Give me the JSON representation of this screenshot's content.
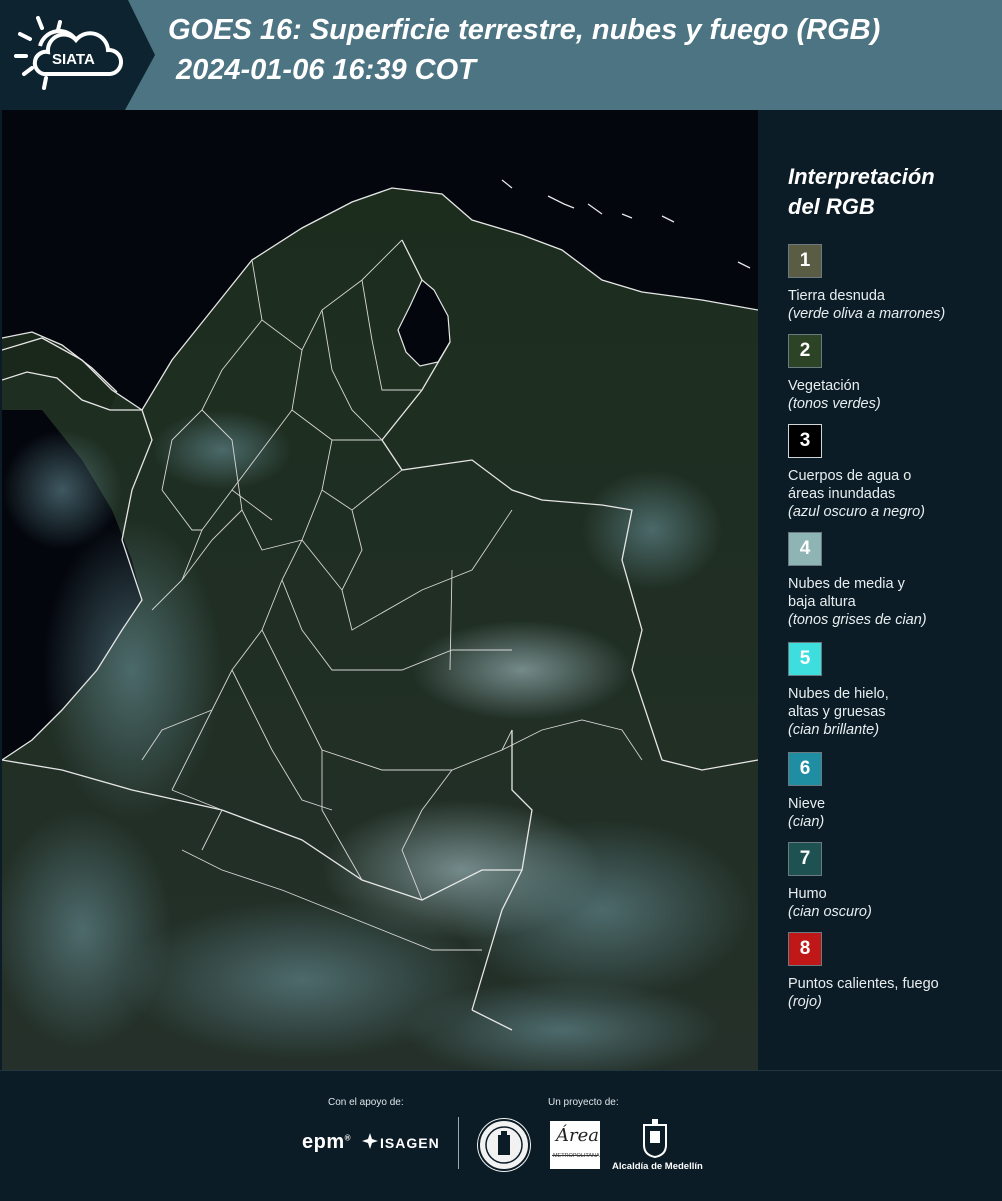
{
  "header": {
    "logo_text": "SIATA",
    "title_line1": "GOES 16: Superficie terrestre, nubes y fuego (RGB)",
    "title_line2": "2024-01-06 16:39 COT"
  },
  "legend": {
    "heading_line1": "Interpretación",
    "heading_line2": "del RGB",
    "items": [
      {
        "number": "1",
        "label": "Tierra desnuda",
        "sub": "(verde oliva a marrones)",
        "color": "#5a5c44"
      },
      {
        "number": "2",
        "label": "Vegetación",
        "sub": "(tonos verdes)",
        "color": "#2d4326"
      },
      {
        "number": "3",
        "label": "Cuerpos de agua o\náreas inundadas",
        "sub": "(azul oscuro a negro)",
        "color": "#000000"
      },
      {
        "number": "4",
        "label": "Nubes de media y\nbaja altura",
        "sub": "(tonos grises de cian)",
        "color": "#8eb4b4"
      },
      {
        "number": "5",
        "label": "Nubes de hielo,\naltas y gruesas",
        "sub": "(cian brillante)",
        "color": "#3fdede"
      },
      {
        "number": "6",
        "label": "Nieve",
        "sub": "(cian)",
        "color": "#1f8ea3"
      },
      {
        "number": "7",
        "label": "Humo",
        "sub": "(cian oscuro)",
        "color": "#1e5151"
      },
      {
        "number": "8",
        "label": "Puntos calientes, fuego",
        "sub": "(rojo)",
        "color": "#c01818"
      }
    ]
  },
  "footer": {
    "support_label": "Con el apoyo de:",
    "project_label": "Un proyecto de:",
    "epm_text": "epm",
    "isagen_text": "ISAGEN",
    "area_text": "METROPOLITANA",
    "area_script": "Área",
    "medellin_text": "Alcaldía de Medellín"
  },
  "colors": {
    "header_dark": "#0d2430",
    "header_teal": "#4d7482",
    "ocean": "#03060c",
    "land": "#1a2a1c",
    "border_lines": "#e6e6e6"
  }
}
